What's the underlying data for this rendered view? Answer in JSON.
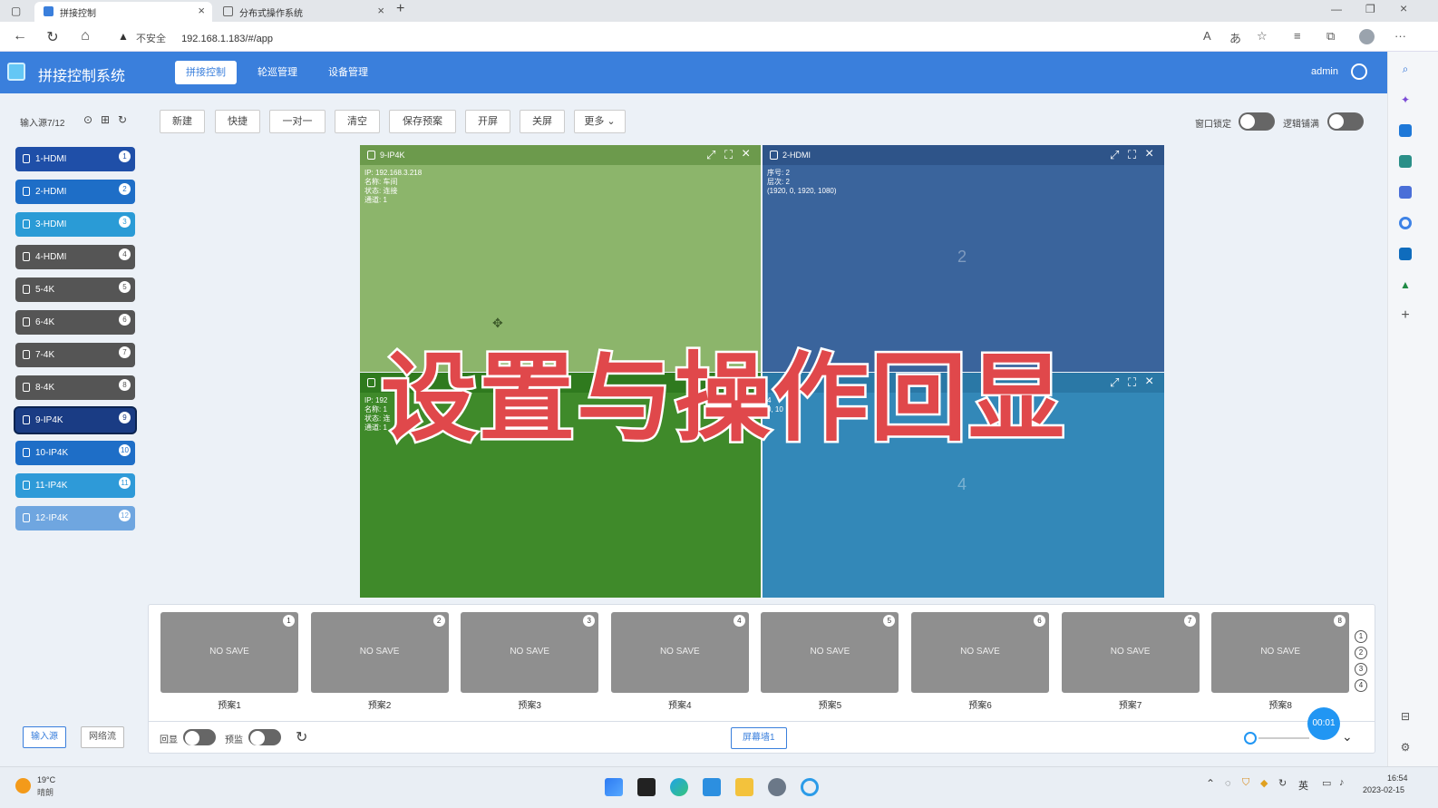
{
  "browser": {
    "tabs": [
      {
        "title": "拼接控制"
      },
      {
        "title": "分布式操作系统"
      }
    ],
    "security_label": "不安全",
    "url": "192.168.1.183/#/app"
  },
  "app": {
    "title": "拼接控制系统",
    "nav": [
      "拼接控制",
      "轮巡管理",
      "设备管理"
    ],
    "user": "admin"
  },
  "sidebar": {
    "header": "输入源7/12",
    "sources": [
      {
        "label": "1-HDMI",
        "num": "1",
        "color": "#1f4fa8"
      },
      {
        "label": "2-HDMI",
        "num": "2",
        "color": "#1e6ec7"
      },
      {
        "label": "3-HDMI",
        "num": "3",
        "color": "#2a9bd6"
      },
      {
        "label": "4-HDMI",
        "num": "4",
        "color": "#555555"
      },
      {
        "label": "5-4K",
        "num": "5",
        "color": "#555555"
      },
      {
        "label": "6-4K",
        "num": "6",
        "color": "#555555"
      },
      {
        "label": "7-4K",
        "num": "7",
        "color": "#555555"
      },
      {
        "label": "8-4K",
        "num": "8",
        "color": "#555555"
      },
      {
        "label": "9-IP4K",
        "num": "9",
        "color": "#1a3c84"
      },
      {
        "label": "10-IP4K",
        "num": "10",
        "color": "#1e6ec7"
      },
      {
        "label": "11-IP4K",
        "num": "11",
        "color": "#2e9ad8"
      },
      {
        "label": "12-IP4K",
        "num": "12",
        "color": "#6fa6e0"
      }
    ],
    "bottom_buttons": [
      "输入源",
      "网络流"
    ]
  },
  "toolbar": {
    "buttons": [
      "新建",
      "快捷",
      "一对一",
      "清空",
      "保存预案",
      "开屏",
      "关屏",
      "更多"
    ],
    "window_lock": "窗口锁定",
    "logic_fill": "逻辑铺满"
  },
  "windows": [
    {
      "title": "9-IP4K",
      "info": "IP: 192.168.3.218\n名称: 车间\n状态: 连接\n通道: 1",
      "bg": "#8cb56b",
      "hdr": "#6c9a4c"
    },
    {
      "title": "2-HDMI",
      "info": "序号: 2\n层次: 2\n(1920, 0, 1920, 1080)",
      "big": "2",
      "bg": "#3a649c",
      "hdr": "#2e5489"
    },
    {
      "title": "",
      "info": "IP: 192\n名称: 1\n状态: 连\n通道: 1",
      "bg": "#3f8a2a",
      "hdr": "#2f7a1e"
    },
    {
      "title": "",
      "info": "4\n0, 10",
      "big": "4",
      "bg": "#3388b8",
      "hdr": "#2a78a6"
    }
  ],
  "overlay_caption": "设置与操作回显",
  "presets": {
    "items": [
      {
        "label": "预案1",
        "num": "1",
        "state": "NO SAVE"
      },
      {
        "label": "预案2",
        "num": "2",
        "state": "NO SAVE"
      },
      {
        "label": "预案3",
        "num": "3",
        "state": "NO SAVE"
      },
      {
        "label": "预案4",
        "num": "4",
        "state": "NO SAVE"
      },
      {
        "label": "预案5",
        "num": "5",
        "state": "NO SAVE"
      },
      {
        "label": "预案6",
        "num": "6",
        "state": "NO SAVE"
      },
      {
        "label": "预案7",
        "num": "7",
        "state": "NO SAVE"
      },
      {
        "label": "预案8",
        "num": "8",
        "state": "NO SAVE"
      }
    ],
    "pages": [
      "1",
      "2",
      "3",
      "4"
    ],
    "echo": "回显",
    "preview": "预监",
    "wall": "屏幕墙1",
    "timer": "00:01"
  },
  "taskbar": {
    "weather_temp": "19°C",
    "weather_desc": "晴朗",
    "ime": "英",
    "time": "16:54",
    "date": "2023-02-15"
  }
}
